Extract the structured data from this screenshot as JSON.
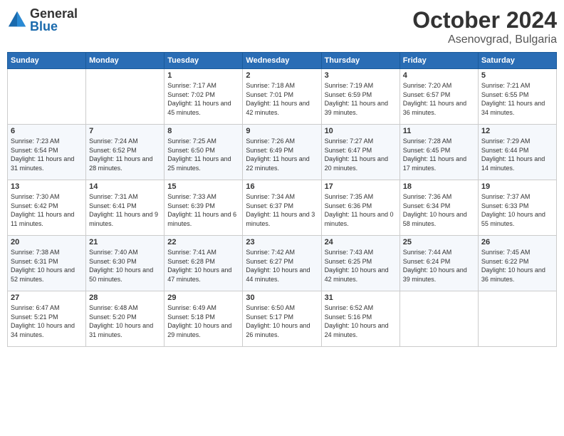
{
  "logo": {
    "general": "General",
    "blue": "Blue"
  },
  "title": "October 2024",
  "location": "Asenovgrad, Bulgaria",
  "days_of_week": [
    "Sunday",
    "Monday",
    "Tuesday",
    "Wednesday",
    "Thursday",
    "Friday",
    "Saturday"
  ],
  "weeks": [
    [
      {
        "day": "",
        "info": ""
      },
      {
        "day": "",
        "info": ""
      },
      {
        "day": "1",
        "info": "Sunrise: 7:17 AM\nSunset: 7:02 PM\nDaylight: 11 hours and 45 minutes."
      },
      {
        "day": "2",
        "info": "Sunrise: 7:18 AM\nSunset: 7:01 PM\nDaylight: 11 hours and 42 minutes."
      },
      {
        "day": "3",
        "info": "Sunrise: 7:19 AM\nSunset: 6:59 PM\nDaylight: 11 hours and 39 minutes."
      },
      {
        "day": "4",
        "info": "Sunrise: 7:20 AM\nSunset: 6:57 PM\nDaylight: 11 hours and 36 minutes."
      },
      {
        "day": "5",
        "info": "Sunrise: 7:21 AM\nSunset: 6:55 PM\nDaylight: 11 hours and 34 minutes."
      }
    ],
    [
      {
        "day": "6",
        "info": "Sunrise: 7:23 AM\nSunset: 6:54 PM\nDaylight: 11 hours and 31 minutes."
      },
      {
        "day": "7",
        "info": "Sunrise: 7:24 AM\nSunset: 6:52 PM\nDaylight: 11 hours and 28 minutes."
      },
      {
        "day": "8",
        "info": "Sunrise: 7:25 AM\nSunset: 6:50 PM\nDaylight: 11 hours and 25 minutes."
      },
      {
        "day": "9",
        "info": "Sunrise: 7:26 AM\nSunset: 6:49 PM\nDaylight: 11 hours and 22 minutes."
      },
      {
        "day": "10",
        "info": "Sunrise: 7:27 AM\nSunset: 6:47 PM\nDaylight: 11 hours and 20 minutes."
      },
      {
        "day": "11",
        "info": "Sunrise: 7:28 AM\nSunset: 6:45 PM\nDaylight: 11 hours and 17 minutes."
      },
      {
        "day": "12",
        "info": "Sunrise: 7:29 AM\nSunset: 6:44 PM\nDaylight: 11 hours and 14 minutes."
      }
    ],
    [
      {
        "day": "13",
        "info": "Sunrise: 7:30 AM\nSunset: 6:42 PM\nDaylight: 11 hours and 11 minutes."
      },
      {
        "day": "14",
        "info": "Sunrise: 7:31 AM\nSunset: 6:41 PM\nDaylight: 11 hours and 9 minutes."
      },
      {
        "day": "15",
        "info": "Sunrise: 7:33 AM\nSunset: 6:39 PM\nDaylight: 11 hours and 6 minutes."
      },
      {
        "day": "16",
        "info": "Sunrise: 7:34 AM\nSunset: 6:37 PM\nDaylight: 11 hours and 3 minutes."
      },
      {
        "day": "17",
        "info": "Sunrise: 7:35 AM\nSunset: 6:36 PM\nDaylight: 11 hours and 0 minutes."
      },
      {
        "day": "18",
        "info": "Sunrise: 7:36 AM\nSunset: 6:34 PM\nDaylight: 10 hours and 58 minutes."
      },
      {
        "day": "19",
        "info": "Sunrise: 7:37 AM\nSunset: 6:33 PM\nDaylight: 10 hours and 55 minutes."
      }
    ],
    [
      {
        "day": "20",
        "info": "Sunrise: 7:38 AM\nSunset: 6:31 PM\nDaylight: 10 hours and 52 minutes."
      },
      {
        "day": "21",
        "info": "Sunrise: 7:40 AM\nSunset: 6:30 PM\nDaylight: 10 hours and 50 minutes."
      },
      {
        "day": "22",
        "info": "Sunrise: 7:41 AM\nSunset: 6:28 PM\nDaylight: 10 hours and 47 minutes."
      },
      {
        "day": "23",
        "info": "Sunrise: 7:42 AM\nSunset: 6:27 PM\nDaylight: 10 hours and 44 minutes."
      },
      {
        "day": "24",
        "info": "Sunrise: 7:43 AM\nSunset: 6:25 PM\nDaylight: 10 hours and 42 minutes."
      },
      {
        "day": "25",
        "info": "Sunrise: 7:44 AM\nSunset: 6:24 PM\nDaylight: 10 hours and 39 minutes."
      },
      {
        "day": "26",
        "info": "Sunrise: 7:45 AM\nSunset: 6:22 PM\nDaylight: 10 hours and 36 minutes."
      }
    ],
    [
      {
        "day": "27",
        "info": "Sunrise: 6:47 AM\nSunset: 5:21 PM\nDaylight: 10 hours and 34 minutes."
      },
      {
        "day": "28",
        "info": "Sunrise: 6:48 AM\nSunset: 5:20 PM\nDaylight: 10 hours and 31 minutes."
      },
      {
        "day": "29",
        "info": "Sunrise: 6:49 AM\nSunset: 5:18 PM\nDaylight: 10 hours and 29 minutes."
      },
      {
        "day": "30",
        "info": "Sunrise: 6:50 AM\nSunset: 5:17 PM\nDaylight: 10 hours and 26 minutes."
      },
      {
        "day": "31",
        "info": "Sunrise: 6:52 AM\nSunset: 5:16 PM\nDaylight: 10 hours and 24 minutes."
      },
      {
        "day": "",
        "info": ""
      },
      {
        "day": "",
        "info": ""
      }
    ]
  ]
}
